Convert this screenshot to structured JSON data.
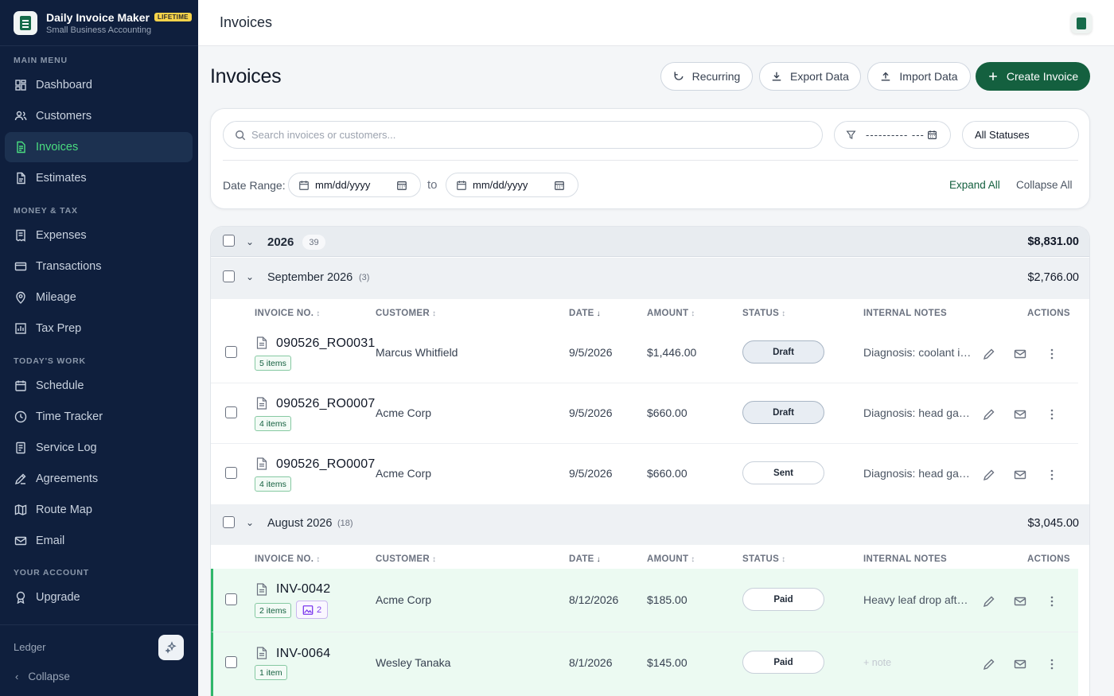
{
  "brand": {
    "title": "Daily Invoice Maker",
    "badge": "LIFETIME",
    "subtitle": "Small Business Accounting"
  },
  "sidebar": {
    "sections": {
      "main": "MAIN MENU",
      "money": "MONEY & TAX",
      "today": "TODAY'S WORK",
      "account": "YOUR ACCOUNT"
    },
    "items": [
      {
        "label": "Dashboard",
        "icon": "dashboard-icon"
      },
      {
        "label": "Customers",
        "icon": "users-icon"
      },
      {
        "label": "Invoices",
        "icon": "invoice-icon",
        "active": true
      },
      {
        "label": "Estimates",
        "icon": "estimate-icon"
      },
      {
        "label": "Expenses",
        "icon": "receipt-icon"
      },
      {
        "label": "Transactions",
        "icon": "card-icon"
      },
      {
        "label": "Mileage",
        "icon": "location-pin-icon"
      },
      {
        "label": "Tax Prep",
        "icon": "chart-icon"
      },
      {
        "label": "Schedule",
        "icon": "calendar-icon"
      },
      {
        "label": "Time Tracker",
        "icon": "clock-icon"
      },
      {
        "label": "Service Log",
        "icon": "log-icon"
      },
      {
        "label": "Agreements",
        "icon": "pen-icon"
      },
      {
        "label": "Route Map",
        "icon": "map-icon"
      },
      {
        "label": "Email",
        "icon": "mail-icon"
      },
      {
        "label": "Upgrade",
        "icon": "upgrade-icon"
      }
    ],
    "footer": {
      "ledger": "Ledger",
      "collapse": "Collapse"
    }
  },
  "topbar": {
    "title": "Invoices"
  },
  "header": {
    "title": "Invoices",
    "buttons": {
      "recurring": "Recurring",
      "export": "Export Data",
      "import": "Import Data",
      "create": "Create Invoice"
    }
  },
  "filters": {
    "search_placeholder": "Search invoices or customers...",
    "date_field": "---------- ---",
    "status": "All Statuses",
    "date_range_label": "Date Range:",
    "date_from": "mm/dd/yyyy",
    "to": "to",
    "date_to": "mm/dd/yyyy",
    "expand_all": "Expand All",
    "collapse_all": "Collapse All"
  },
  "table": {
    "columns": [
      "INVOICE NO.",
      "CUSTOMER",
      "DATE",
      "AMOUNT",
      "STATUS",
      "INTERNAL NOTES",
      "ACTIONS"
    ],
    "year": {
      "label": "2026",
      "count": "39",
      "total": "$8,831.00"
    },
    "groups": [
      {
        "label": "September 2026",
        "count": "(3)",
        "total": "$2,766.00",
        "rows": [
          {
            "no": "090526_RO0031",
            "items": "5 items",
            "customer": "Marcus Whitfield",
            "date": "9/5/2026",
            "amount": "$1,446.00",
            "status": "Draft",
            "notes": "Diagnosis: coolant in ..."
          },
          {
            "no": "090526_RO0007",
            "items": "4 items",
            "customer": "Acme Corp",
            "date": "9/5/2026",
            "amount": "$660.00",
            "status": "Draft",
            "notes": "Diagnosis: head gas..."
          },
          {
            "no": "090526_RO0007",
            "items": "4 items",
            "customer": "Acme Corp",
            "date": "9/5/2026",
            "amount": "$660.00",
            "status": "Sent",
            "notes": "Diagnosis: head gas..."
          }
        ]
      },
      {
        "label": "August 2026",
        "count": "(18)",
        "total": "$3,045.00",
        "rows": [
          {
            "no": "INV-0042",
            "items": "2 items",
            "images": "2",
            "customer": "Acme Corp",
            "date": "8/12/2026",
            "amount": "$185.00",
            "status": "Paid",
            "notes": "Heavy leaf drop after..."
          },
          {
            "no": "INV-0064",
            "items": "1 item",
            "customer": "Wesley Tanaka",
            "date": "8/1/2026",
            "amount": "$145.00",
            "status": "Paid",
            "notes": "+ note"
          }
        ]
      }
    ]
  }
}
